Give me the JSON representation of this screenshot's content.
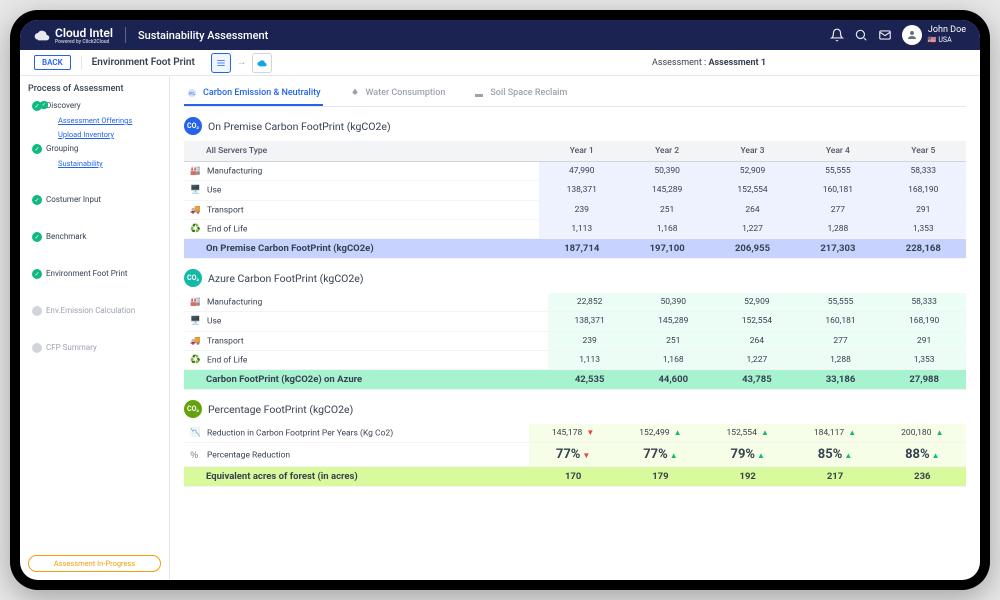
{
  "header": {
    "brand": "Cloud Intel",
    "brand_sub": "Powered by Click2Cloud",
    "module": "Sustainability Assessment",
    "user_name": "John Doe",
    "user_country": "🇺🇸 USA"
  },
  "subbar": {
    "back": "BACK",
    "page_title": "Environment Foot Print",
    "assessment_prefix": "Assessment : ",
    "assessment_value": "Assessment 1"
  },
  "sidebar": {
    "title": "Process of Assessment",
    "steps": {
      "discovery": "Discovery",
      "assessment_offerings": "Assessment Offerings",
      "upload_inventory": "Upload Inventory",
      "grouping": "Grouping",
      "sustainability": "Sustainability",
      "costumer_input": "Costumer Input",
      "benchmark": "Benchmark",
      "environment_foot_print": "Environment Foot Print",
      "env_emission_calc": "Env.Emission Calculation",
      "cfp_summary": "CFP Summary"
    },
    "status": "Assessment In-Progress"
  },
  "tabs": {
    "carbon": "Carbon Emission & Neutrality",
    "water": "Water Consumption",
    "soil": "Soil Space Reclaim"
  },
  "years": [
    "Year 1",
    "Year 2",
    "Year 3",
    "Year 4",
    "Year 5"
  ],
  "row_headers": {
    "all_servers": "All Servers Type",
    "manufacturing": "Manufacturing",
    "use": "Use",
    "transport": "Transport",
    "eol": "End of Life"
  },
  "onprem": {
    "title": "On Premise Carbon FootPrint (kgCO2e)",
    "total_label": "On Premise Carbon FootPrint (kgCO2e)",
    "manufacturing": [
      "47,990",
      "50,390",
      "52,909",
      "55,555",
      "58,333"
    ],
    "use": [
      "138,371",
      "145,289",
      "152,554",
      "160,181",
      "168,190"
    ],
    "transport": [
      "239",
      "251",
      "264",
      "277",
      "291"
    ],
    "eol": [
      "1,113",
      "1,168",
      "1,227",
      "1,288",
      "1,353"
    ],
    "total": [
      "187,714",
      "197,100",
      "206,955",
      "217,303",
      "228,168"
    ]
  },
  "azure": {
    "title": "Azure Carbon FootPrint (kgCO2e)",
    "total_label": "Carbon FootPrint (kgCO2e) on Azure",
    "manufacturing": [
      "22,852",
      "50,390",
      "52,909",
      "55,555",
      "58,333"
    ],
    "use": [
      "138,371",
      "145,289",
      "152,554",
      "160,181",
      "168,190"
    ],
    "transport": [
      "239",
      "251",
      "264",
      "277",
      "291"
    ],
    "eol": [
      "1,113",
      "1,168",
      "1,227",
      "1,288",
      "1,353"
    ],
    "total": [
      "42,535",
      "44,600",
      "43,785",
      "33,186",
      "27,988"
    ]
  },
  "pct": {
    "title": "Percentage FootPrint (kgCO2e)",
    "reduction_label": "Reduction in Carbon Footprint Per Years (Kg Co2)",
    "pct_label": "Percentage Reduction",
    "forest_label": "Equivalent acres of forest (in acres)",
    "reduction": [
      "145,178",
      "152,499",
      "152,554",
      "184,117",
      "200,180"
    ],
    "reduction_dir": [
      "down",
      "up",
      "up",
      "up",
      "up"
    ],
    "pct": [
      "77%",
      "77%",
      "79%",
      "85%",
      "88%"
    ],
    "pct_dir": [
      "down",
      "up",
      "up",
      "up",
      "up"
    ],
    "forest": [
      "170",
      "179",
      "192",
      "217",
      "236"
    ]
  },
  "chart_data": [
    {
      "type": "table",
      "title": "On Premise Carbon FootPrint (kgCO2e)",
      "categories": [
        "Year 1",
        "Year 2",
        "Year 3",
        "Year 4",
        "Year 5"
      ],
      "series": [
        {
          "name": "Manufacturing",
          "values": [
            47990,
            50390,
            52909,
            55555,
            58333
          ]
        },
        {
          "name": "Use",
          "values": [
            138371,
            145289,
            152554,
            160181,
            168190
          ]
        },
        {
          "name": "Transport",
          "values": [
            239,
            251,
            264,
            277,
            291
          ]
        },
        {
          "name": "End of Life",
          "values": [
            1113,
            1168,
            1227,
            1288,
            1353
          ]
        },
        {
          "name": "Total",
          "values": [
            187714,
            197100,
            206955,
            217303,
            228168
          ]
        }
      ]
    },
    {
      "type": "table",
      "title": "Azure Carbon FootPrint (kgCO2e)",
      "categories": [
        "Year 1",
        "Year 2",
        "Year 3",
        "Year 4",
        "Year 5"
      ],
      "series": [
        {
          "name": "Manufacturing",
          "values": [
            22852,
            50390,
            52909,
            55555,
            58333
          ]
        },
        {
          "name": "Use",
          "values": [
            138371,
            145289,
            152554,
            160181,
            168190
          ]
        },
        {
          "name": "Transport",
          "values": [
            239,
            251,
            264,
            277,
            291
          ]
        },
        {
          "name": "End of Life",
          "values": [
            1113,
            1168,
            1227,
            1288,
            1353
          ]
        },
        {
          "name": "Total",
          "values": [
            42535,
            44600,
            43785,
            33186,
            27988
          ]
        }
      ]
    },
    {
      "type": "table",
      "title": "Percentage FootPrint (kgCO2e)",
      "categories": [
        "Year 1",
        "Year 2",
        "Year 3",
        "Year 4",
        "Year 5"
      ],
      "series": [
        {
          "name": "Reduction in Carbon Footprint Per Years (Kg Co2)",
          "values": [
            145178,
            152499,
            152554,
            184117,
            200180
          ]
        },
        {
          "name": "Percentage Reduction",
          "values": [
            77,
            77,
            79,
            85,
            88
          ]
        },
        {
          "name": "Equivalent acres of forest (in acres)",
          "values": [
            170,
            179,
            192,
            217,
            236
          ]
        }
      ]
    }
  ]
}
